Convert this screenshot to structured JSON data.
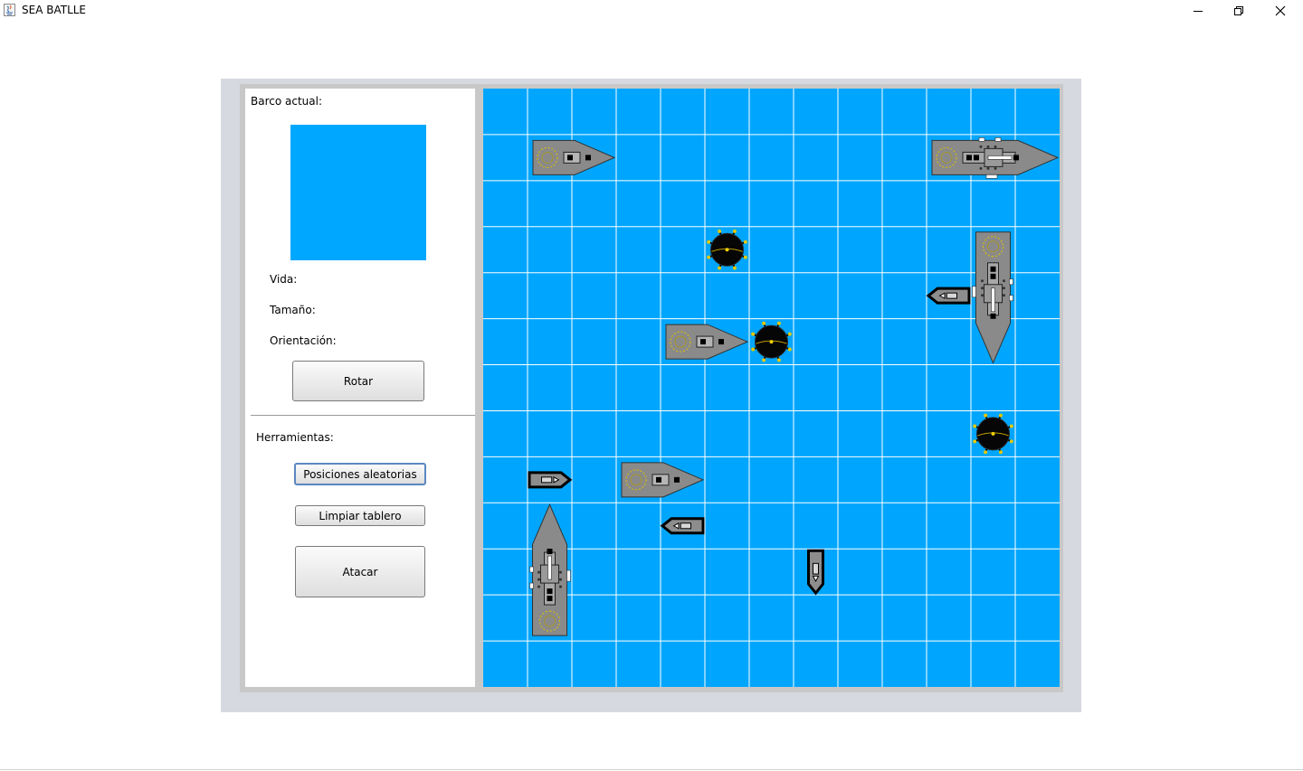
{
  "window": {
    "title": "SEA BATLLE",
    "controls": [
      "minimize-icon",
      "restore-icon",
      "close-icon"
    ]
  },
  "left_panel": {
    "current_ship_label": "Barco actual:",
    "preview_color": "#00a7fe",
    "life_label": "Vida:",
    "size_label": "Tamaño:",
    "orientation_label": "Orientación:",
    "rotate_button": "Rotar",
    "tools_label": "Herramientas:",
    "random_button": "Posiciones aleatorias",
    "clear_button": "Limpiar tablero",
    "attack_button": "Atacar"
  },
  "board": {
    "columns": 13,
    "rows": 13,
    "water_color": "#00a6fd",
    "grid_color": "#ffffff",
    "pieces": [
      {
        "type": "destroyer",
        "col": 1,
        "row": 1,
        "length": 2,
        "orientation": "horizontal"
      },
      {
        "type": "carrier",
        "col": 10,
        "row": 1,
        "length": 3,
        "orientation": "horizontal"
      },
      {
        "type": "mine",
        "col": 5,
        "row": 3
      },
      {
        "type": "carrier",
        "col": 11,
        "row": 3,
        "length": 3,
        "orientation": "vertical"
      },
      {
        "type": "boat",
        "col": 10,
        "row": 4,
        "length": 1,
        "orientation": "horizontal"
      },
      {
        "type": "destroyer",
        "col": 4,
        "row": 5,
        "length": 2,
        "orientation": "horizontal"
      },
      {
        "type": "mine",
        "col": 6,
        "row": 5
      },
      {
        "type": "mine",
        "col": 11,
        "row": 7
      },
      {
        "type": "boat",
        "col": 1,
        "row": 8,
        "length": 1,
        "orientation": "horizontal"
      },
      {
        "type": "destroyer",
        "col": 3,
        "row": 8,
        "length": 2,
        "orientation": "horizontal"
      },
      {
        "type": "boat",
        "col": 4,
        "row": 9,
        "length": 1,
        "orientation": "horizontal"
      },
      {
        "type": "carrier",
        "col": 1,
        "row": 9,
        "length": 3,
        "orientation": "vertical"
      },
      {
        "type": "boat",
        "col": 7,
        "row": 10,
        "length": 1,
        "orientation": "vertical"
      }
    ]
  }
}
